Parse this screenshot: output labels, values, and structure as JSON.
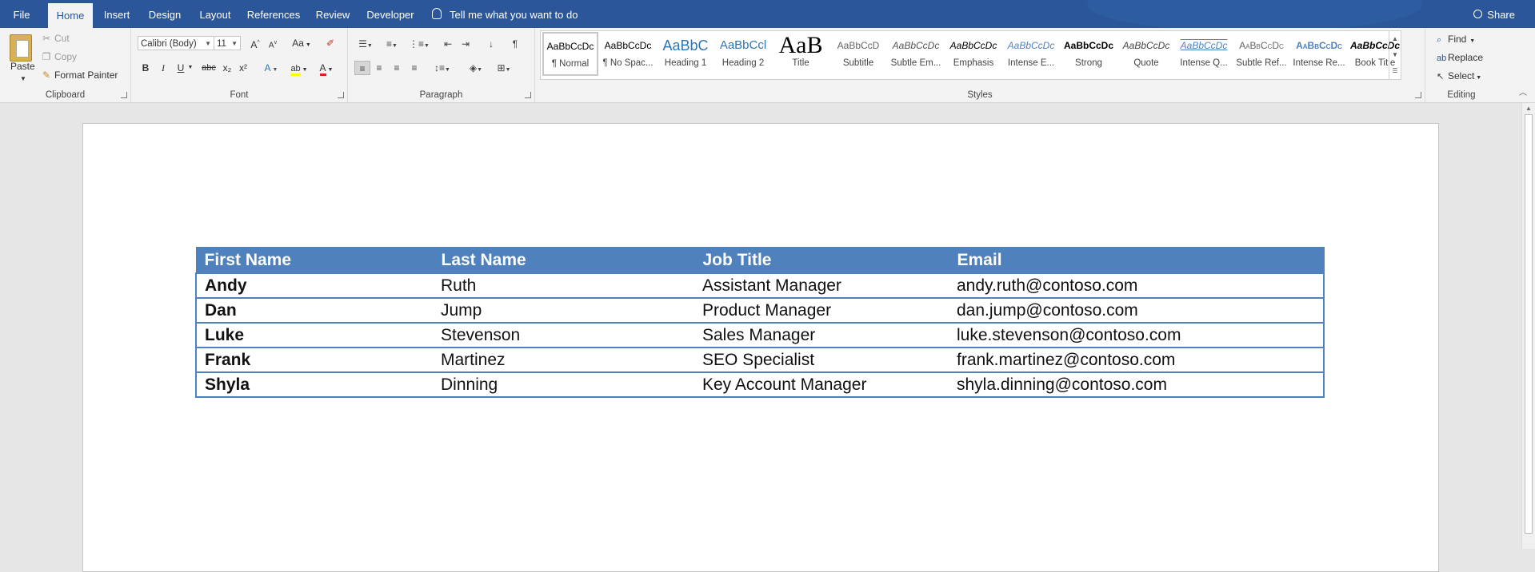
{
  "tabs": [
    "File",
    "Home",
    "Insert",
    "Design",
    "Layout",
    "References",
    "Review",
    "Developer"
  ],
  "active_tab": "Home",
  "tell_me": "Tell me what you want to do",
  "share": "Share",
  "clipboard": {
    "paste": "Paste",
    "cut": "Cut",
    "copy": "Copy",
    "format_painter": "Format Painter",
    "label": "Clipboard"
  },
  "font": {
    "name": "Calibri (Body)",
    "size": "11",
    "label": "Font",
    "bold": "B",
    "italic": "I",
    "underline": "U",
    "strike": "abc",
    "subscript": "x₂",
    "superscript": "x²",
    "grow": "A",
    "shrink": "A",
    "case": "Aa"
  },
  "paragraph": {
    "label": "Paragraph"
  },
  "styles": {
    "label": "Styles",
    "items": [
      {
        "preview": "AaBbCcDc",
        "name": "¶ Normal"
      },
      {
        "preview": "AaBbCcDc",
        "name": "¶ No Spac..."
      },
      {
        "preview": "AaBbC",
        "name": "Heading 1"
      },
      {
        "preview": "AaBbCcl",
        "name": "Heading 2"
      },
      {
        "preview": "AaB",
        "name": "Title"
      },
      {
        "preview": "AaBbCcD",
        "name": "Subtitle"
      },
      {
        "preview": "AaBbCcDc",
        "name": "Subtle Em..."
      },
      {
        "preview": "AaBbCcDc",
        "name": "Emphasis"
      },
      {
        "preview": "AaBbCcDc",
        "name": "Intense E..."
      },
      {
        "preview": "AaBbCcDc",
        "name": "Strong"
      },
      {
        "preview": "AaBbCcDc",
        "name": "Quote"
      },
      {
        "preview": "AaBbCcDc",
        "name": "Intense Q..."
      },
      {
        "preview": "AaBbCcDc",
        "name": "Subtle Ref..."
      },
      {
        "preview": "AaBbCcDc",
        "name": "Intense Re..."
      },
      {
        "preview": "AaBbCcDc",
        "name": "Book Title"
      }
    ]
  },
  "editing": {
    "find": "Find",
    "replace": "Replace",
    "select": "Select",
    "label": "Editing"
  },
  "table": {
    "headers": [
      "First Name",
      "Last Name",
      "Job Title",
      "Email"
    ],
    "rows": [
      [
        "Andy",
        "Ruth",
        "Assistant Manager",
        "andy.ruth@contoso.com"
      ],
      [
        "Dan",
        "Jump",
        "Product Manager",
        "dan.jump@contoso.com"
      ],
      [
        "Luke",
        "Stevenson",
        "Sales Manager",
        "luke.stevenson@contoso.com"
      ],
      [
        "Frank",
        "Martinez",
        "SEO Specialist",
        "frank.martinez@contoso.com"
      ],
      [
        "Shyla",
        "Dinning",
        "Key Account Manager",
        "shyla.dinning@contoso.com"
      ]
    ]
  },
  "colors": {
    "title_bar": "#2b579a",
    "table_header": "#4f81bd",
    "table_border": "#4f81bd"
  }
}
